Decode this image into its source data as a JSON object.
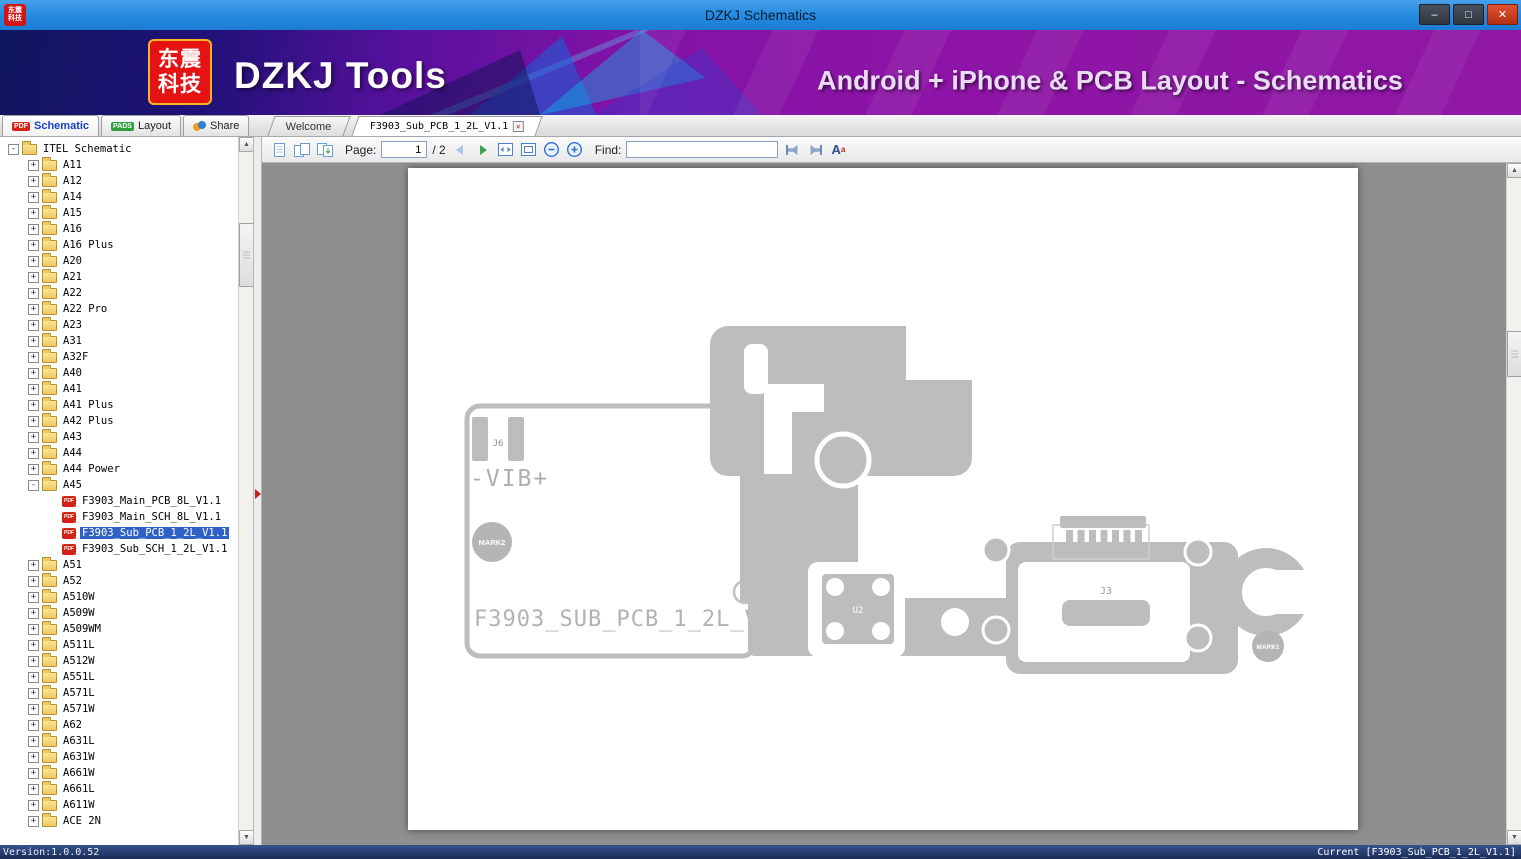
{
  "window": {
    "title": "DZKJ Schematics",
    "controls": {
      "minimize": "–",
      "maximize": "□",
      "close": "✕"
    }
  },
  "banner": {
    "logo_line1": "东震",
    "logo_line2": "科技",
    "app_name": "DZKJ Tools",
    "tagline": "Android + iPhone & PCB Layout - Schematics"
  },
  "tabs": {
    "main": [
      {
        "label": "Schematic",
        "badge": "PDF"
      },
      {
        "label": "Layout",
        "badge": "PADS"
      },
      {
        "label": "Share"
      }
    ],
    "documents": [
      {
        "label": "Welcome"
      },
      {
        "label": "F3903_Sub_PCB_1_2L_V1.1",
        "close_label": "✕"
      }
    ]
  },
  "toolbar": {
    "page_label": "Page:",
    "page_value": "1",
    "page_total": "/ 2",
    "find_label": "Find:",
    "find_value": "",
    "text_size_label": "A",
    "text_size_sup": "a"
  },
  "tree": {
    "items": [
      {
        "label": "ITEL Schematic",
        "level": 0,
        "kind": "folder",
        "expand": "-"
      },
      {
        "label": "A11",
        "level": 1,
        "kind": "folder",
        "expand": "+"
      },
      {
        "label": "A12",
        "level": 1,
        "kind": "folder",
        "expand": "+"
      },
      {
        "label": "A14",
        "level": 1,
        "kind": "folder",
        "expand": "+"
      },
      {
        "label": "A15",
        "level": 1,
        "kind": "folder",
        "expand": "+"
      },
      {
        "label": "A16",
        "level": 1,
        "kind": "folder",
        "expand": "+"
      },
      {
        "label": "A16 Plus",
        "level": 1,
        "kind": "folder",
        "expand": "+"
      },
      {
        "label": "A20",
        "level": 1,
        "kind": "folder",
        "expand": "+"
      },
      {
        "label": "A21",
        "level": 1,
        "kind": "folder",
        "expand": "+"
      },
      {
        "label": "A22",
        "level": 1,
        "kind": "folder",
        "expand": "+"
      },
      {
        "label": "A22 Pro",
        "level": 1,
        "kind": "folder",
        "expand": "+"
      },
      {
        "label": "A23",
        "level": 1,
        "kind": "folder",
        "expand": "+"
      },
      {
        "label": "A31",
        "level": 1,
        "kind": "folder",
        "expand": "+"
      },
      {
        "label": "A32F",
        "level": 1,
        "kind": "folder",
        "expand": "+"
      },
      {
        "label": "A40",
        "level": 1,
        "kind": "folder",
        "expand": "+"
      },
      {
        "label": "A41",
        "level": 1,
        "kind": "folder",
        "expand": "+"
      },
      {
        "label": "A41 Plus",
        "level": 1,
        "kind": "folder",
        "expand": "+"
      },
      {
        "label": "A42 Plus",
        "level": 1,
        "kind": "folder",
        "expand": "+"
      },
      {
        "label": "A43",
        "level": 1,
        "kind": "folder",
        "expand": "+"
      },
      {
        "label": "A44",
        "level": 1,
        "kind": "folder",
        "expand": "+"
      },
      {
        "label": "A44 Power",
        "level": 1,
        "kind": "folder",
        "expand": "+"
      },
      {
        "label": "A45",
        "level": 1,
        "kind": "folder",
        "expand": "-"
      },
      {
        "label": "F3903_Main_PCB_8L_V1.1",
        "level": 2,
        "kind": "pdf"
      },
      {
        "label": "F3903_Main_SCH_8L_V1.1",
        "level": 2,
        "kind": "pdf"
      },
      {
        "label": "F3903_Sub_PCB_1_2L_V1.1",
        "level": 2,
        "kind": "pdf",
        "selected": true
      },
      {
        "label": "F3903_Sub_SCH_1_2L_V1.1",
        "level": 2,
        "kind": "pdf"
      },
      {
        "label": "A51",
        "level": 1,
        "kind": "folder",
        "expand": "+"
      },
      {
        "label": "A52",
        "level": 1,
        "kind": "folder",
        "expand": "+"
      },
      {
        "label": "A510W",
        "level": 1,
        "kind": "folder",
        "expand": "+"
      },
      {
        "label": "A509W",
        "level": 1,
        "kind": "folder",
        "expand": "+"
      },
      {
        "label": "A509WM",
        "level": 1,
        "kind": "folder",
        "expand": "+"
      },
      {
        "label": "A511L",
        "level": 1,
        "kind": "folder",
        "expand": "+"
      },
      {
        "label": "A512W",
        "level": 1,
        "kind": "folder",
        "expand": "+"
      },
      {
        "label": "A551L",
        "level": 1,
        "kind": "folder",
        "expand": "+"
      },
      {
        "label": "A571L",
        "level": 1,
        "kind": "folder",
        "expand": "+"
      },
      {
        "label": "A571W",
        "level": 1,
        "kind": "folder",
        "expand": "+"
      },
      {
        "label": "A62",
        "level": 1,
        "kind": "folder",
        "expand": "+"
      },
      {
        "label": "A631L",
        "level": 1,
        "kind": "folder",
        "expand": "+"
      },
      {
        "label": "A631W",
        "level": 1,
        "kind": "folder",
        "expand": "+"
      },
      {
        "label": "A661W",
        "level": 1,
        "kind": "folder",
        "expand": "+"
      },
      {
        "label": "A661L",
        "level": 1,
        "kind": "folder",
        "expand": "+"
      },
      {
        "label": "A611W",
        "level": 1,
        "kind": "folder",
        "expand": "+"
      },
      {
        "label": "ACE 2N",
        "level": 1,
        "kind": "folder",
        "expand": "+"
      }
    ]
  },
  "pcb": {
    "title_text": "F3903_SUB_PCB_1_2L_V1.1",
    "vib_label": "-VIB+",
    "j6_label": "J6",
    "u2_label": "U2",
    "j3_label": "J3",
    "mark1_label": "MARK1",
    "mark2_label": "MARK2"
  },
  "statusbar": {
    "version": "Version:1.0.0.52",
    "current": "Current [F3903_Sub_PCB_1_2L_V1.1]"
  },
  "colors": {
    "titlebar_blue": "#2389e0",
    "banner_purple": "#8d14a6",
    "selection_blue": "#2f62c4",
    "pdf_red": "#d42316",
    "pads_green": "#2f9e3f",
    "close_red": "#c22516",
    "board_gray": "#bdbdbd"
  }
}
